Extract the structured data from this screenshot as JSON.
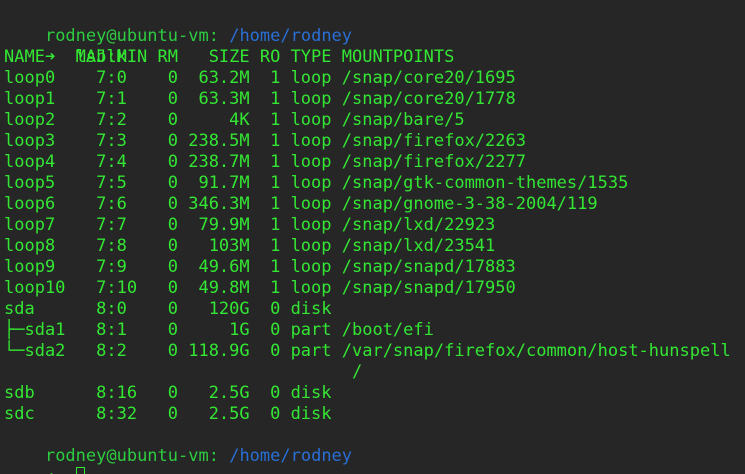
{
  "prompt": {
    "user_host": "rodney@ubuntu-vm",
    "separator": ":",
    "path": " /home/rodney",
    "arrow": "➜",
    "command": "lsblk"
  },
  "table": {
    "header": "NAME   MAJ:MIN RM   SIZE RO TYPE MOUNTPOINTS",
    "rows": [
      "loop0    7:0    0  63.2M  1 loop /snap/core20/1695",
      "loop1    7:1    0  63.3M  1 loop /snap/core20/1778",
      "loop2    7:2    0     4K  1 loop /snap/bare/5",
      "loop3    7:3    0 238.5M  1 loop /snap/firefox/2263",
      "loop4    7:4    0 238.7M  1 loop /snap/firefox/2277",
      "loop5    7:5    0  91.7M  1 loop /snap/gtk-common-themes/1535",
      "loop6    7:6    0 346.3M  1 loop /snap/gnome-3-38-2004/119",
      "loop7    7:7    0  79.9M  1 loop /snap/lxd/22923",
      "loop8    7:8    0   103M  1 loop /snap/lxd/23541",
      "loop9    7:9    0  49.6M  1 loop /snap/snapd/17883",
      "loop10   7:10   0  49.8M  1 loop /snap/snapd/17950",
      "sda      8:0    0   120G  0 disk ",
      "├─sda1   8:1    0     1G  0 part /boot/efi",
      "└─sda2   8:2    0 118.9G  0 part /var/snap/firefox/common/host-hunspell",
      "                                  /",
      "sdb      8:16   0   2.5G  0 disk ",
      "sdc      8:32   0   2.5G  0 disk "
    ]
  },
  "prompt2": {
    "user_host": "rodney@ubuntu-vm",
    "separator": ":",
    "path": " /home/rodney",
    "arrow": "➜"
  }
}
